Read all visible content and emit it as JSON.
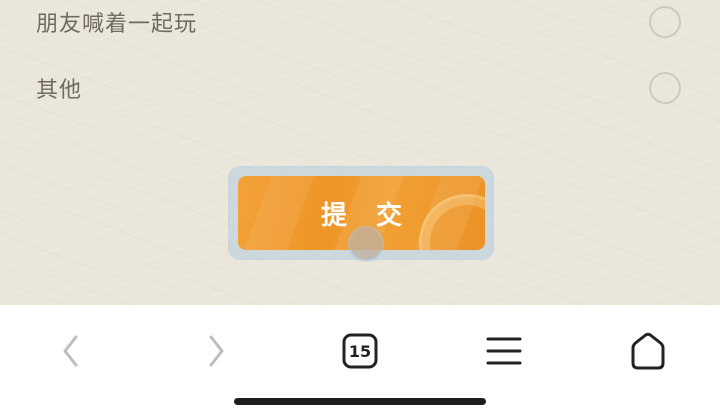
{
  "options": [
    {
      "label": "朋友喊着一起玩",
      "selected": false
    },
    {
      "label": "其他",
      "selected": false
    }
  ],
  "submit": {
    "label": "提 交"
  },
  "toolbar": {
    "back_icon": "chevron-left-icon",
    "forward_icon": "chevron-right-icon",
    "tabs_count": "15",
    "menu_icon": "hamburger-menu-icon",
    "home_icon": "home-icon"
  },
  "colors": {
    "background": "#ebe6da",
    "option_text": "#6f6a62",
    "submit_button": "#ee9526",
    "submit_text": "#ffffff",
    "toolbar_active": "#222222",
    "toolbar_disabled": "#bdbdbd"
  }
}
